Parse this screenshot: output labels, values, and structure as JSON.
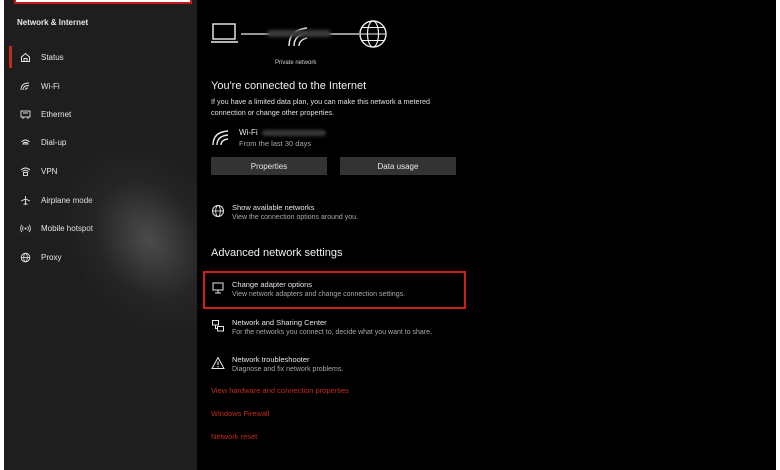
{
  "sidebar": {
    "section_title": "Network & Internet",
    "items": [
      {
        "label": "Status",
        "icon": "home-icon"
      },
      {
        "label": "Wi-Fi",
        "icon": "wifi-icon"
      },
      {
        "label": "Ethernet",
        "icon": "ethernet-icon"
      },
      {
        "label": "Dial-up",
        "icon": "dialup-icon"
      },
      {
        "label": "VPN",
        "icon": "vpn-icon"
      },
      {
        "label": "Airplane mode",
        "icon": "airplane-icon"
      },
      {
        "label": "Mobile hotspot",
        "icon": "hotspot-icon"
      },
      {
        "label": "Proxy",
        "icon": "globe-icon"
      }
    ]
  },
  "status": {
    "network_type": "Private network",
    "heading": "You're connected to the Internet",
    "description": "If you have a limited data plan, you can make this network a metered connection or change other properties.",
    "connection_label": "Wi-Fi",
    "connection_sub": "From the last 30 days",
    "properties_button": "Properties",
    "data_usage_button": "Data usage"
  },
  "show_networks": {
    "title": "Show available networks",
    "subtitle": "View the connection options around you."
  },
  "advanced": {
    "heading": "Advanced network settings",
    "items": [
      {
        "title": "Change adapter options",
        "subtitle": "View network adapters and change connection settings."
      },
      {
        "title": "Network and Sharing Center",
        "subtitle": "For the networks you connect to, decide what you want to share."
      },
      {
        "title": "Network troubleshooter",
        "subtitle": "Diagnose and fix network problems."
      }
    ],
    "links": [
      "View hardware and connection properties",
      "Windows Firewall",
      "Network reset"
    ]
  },
  "colors": {
    "accent_red": "#c42b1c",
    "highlight_red": "#d11a1a",
    "background": "#000000",
    "sidebar_bg": "#1e1e1e"
  }
}
